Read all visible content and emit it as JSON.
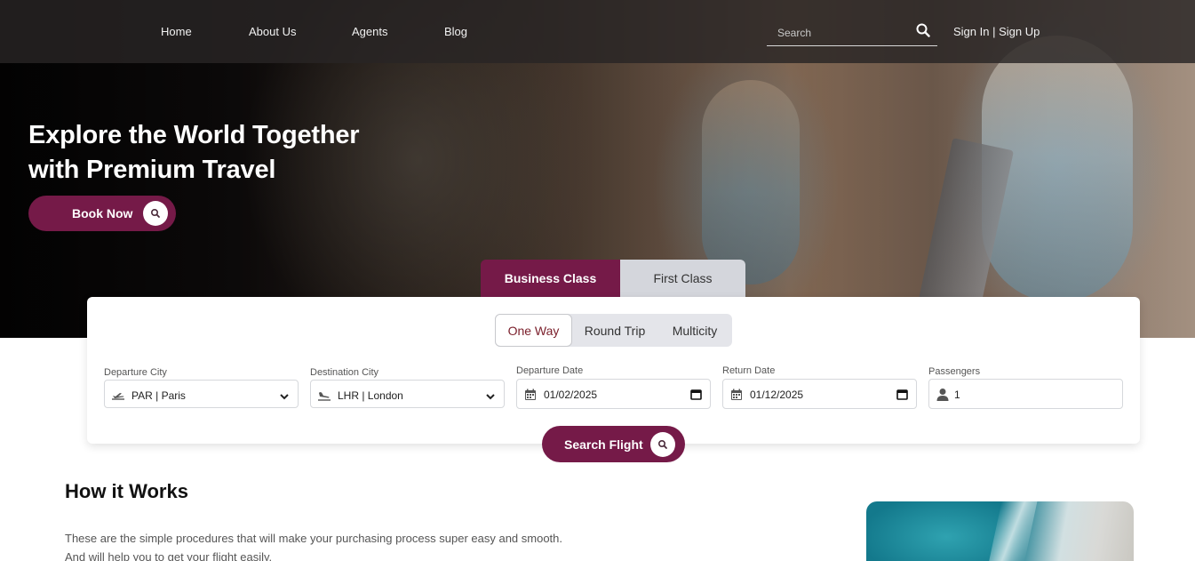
{
  "nav": {
    "links": [
      "Home",
      "About Us",
      "Agents",
      "Blog"
    ],
    "search_placeholder": "Search",
    "auth": "Sign In | Sign Up"
  },
  "hero": {
    "title_line1": "Explore the World Together",
    "title_line2": "with Premium Travel",
    "book_button": "Book Now"
  },
  "class_tabs": {
    "business": "Business Class",
    "first": "First Class",
    "selected": "Business Class"
  },
  "trip_types": {
    "options": [
      "One Way",
      "Round Trip",
      "Multicity"
    ],
    "selected": "One Way"
  },
  "form": {
    "departure_city": {
      "label": "Departure City",
      "value": "PAR | Paris"
    },
    "destination_city": {
      "label": "Destination City",
      "value": "LHR | London"
    },
    "departure_date": {
      "label": "Departure Date",
      "value": "01/02/2025"
    },
    "return_date": {
      "label": "Return Date",
      "value": "01/12/2025"
    },
    "passengers": {
      "label": "Passengers",
      "value": "1"
    }
  },
  "search_button": "Search Flight",
  "how_it_works": {
    "title": "How it Works",
    "text": "These are the simple procedures that will make your purchasing process super easy and smooth. And will help you to get your flight easily."
  },
  "colors": {
    "accent": "#751a48",
    "nav_bg": "#282424",
    "tab_inactive": "#d4d6dc"
  }
}
